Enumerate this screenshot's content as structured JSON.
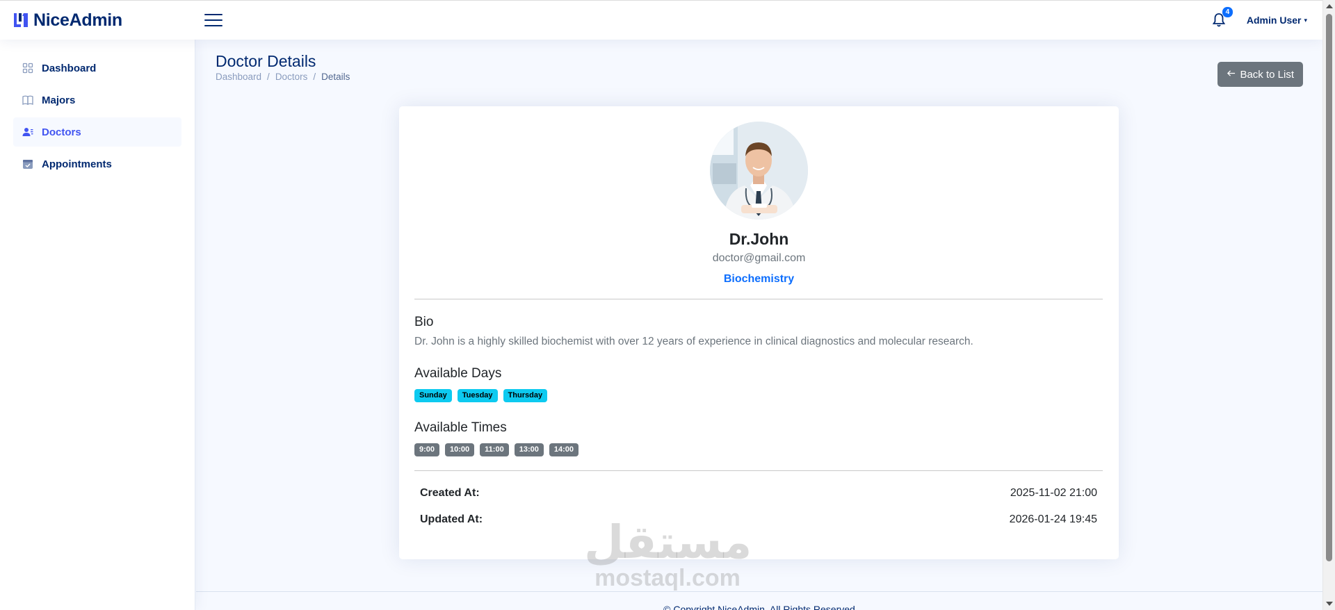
{
  "brand": {
    "name": "NiceAdmin",
    "logo_icon": "logo-icon",
    "accent": "#4154f1",
    "primary": "#012970"
  },
  "header": {
    "menu_icon": "hamburger-icon",
    "notification_icon": "bell-icon",
    "notification_count": "4",
    "user_name": "Admin User"
  },
  "sidebar": {
    "items": [
      {
        "label": "Dashboard",
        "icon": "grid-icon",
        "active": false
      },
      {
        "label": "Majors",
        "icon": "book-icon",
        "active": false
      },
      {
        "label": "Doctors",
        "icon": "users-icon",
        "active": true
      },
      {
        "label": "Appointments",
        "icon": "calendar-check-icon",
        "active": false
      }
    ]
  },
  "page": {
    "title": "Doctor Details",
    "breadcrumb": [
      "Dashboard",
      "Doctors",
      "Details"
    ],
    "back_button": "Back to List"
  },
  "doctor": {
    "name": "Dr.John",
    "email": "doctor@gmail.com",
    "major": "Biochemistry",
    "bio_title": "Bio",
    "bio": "Dr. John is a highly skilled biochemist with over 12 years of experience in clinical diagnostics and molecular research.",
    "days_title": "Available Days",
    "days": [
      "Sunday",
      "Tuesday",
      "Thursday"
    ],
    "times_title": "Available Times",
    "times": [
      "9:00",
      "10:00",
      "11:00",
      "13:00",
      "14:00"
    ],
    "created_label": "Created At:",
    "created_value": "2025-11-02 21:00",
    "updated_label": "Updated At:",
    "updated_value": "2026-01-24 19:45"
  },
  "footer": {
    "text": "© Copyright NiceAdmin. All Rights Reserved"
  },
  "watermark": {
    "arabic": "مستقل",
    "latin": "mostaql.com"
  }
}
